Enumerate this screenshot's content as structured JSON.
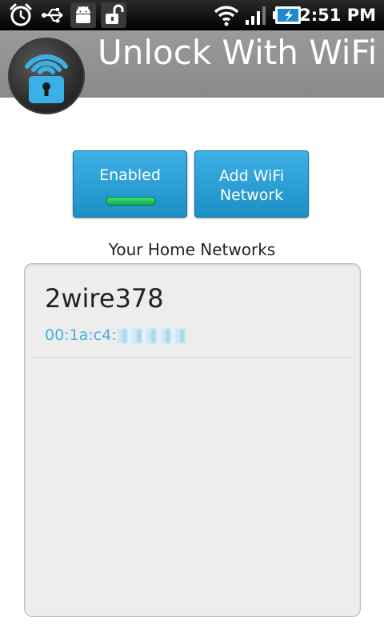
{
  "status_bar": {
    "time": "2:51 PM",
    "icons": [
      "alarm-clock-icon",
      "usb-icon",
      "android-debug-icon",
      "unlock-icon",
      "wifi-signal-icon",
      "cell-signal-icon",
      "battery-charging-icon"
    ]
  },
  "app": {
    "title": "Unlock With WiFi",
    "logo_icon": "wifi-padlock-logo-icon"
  },
  "buttons": {
    "enabled_label": "Enabled",
    "add_network_label": "Add WiFi\nNetwork",
    "indicator_color": "#1fbf5e"
  },
  "home_networks": {
    "heading": "Your Home Networks",
    "items": [
      {
        "name": "2wire378",
        "mac_visible": "00:1a:c4:"
      }
    ]
  },
  "colors": {
    "accent": "#2aa1d6",
    "mac_text": "#3fb3de",
    "header_bg": "#959595"
  }
}
